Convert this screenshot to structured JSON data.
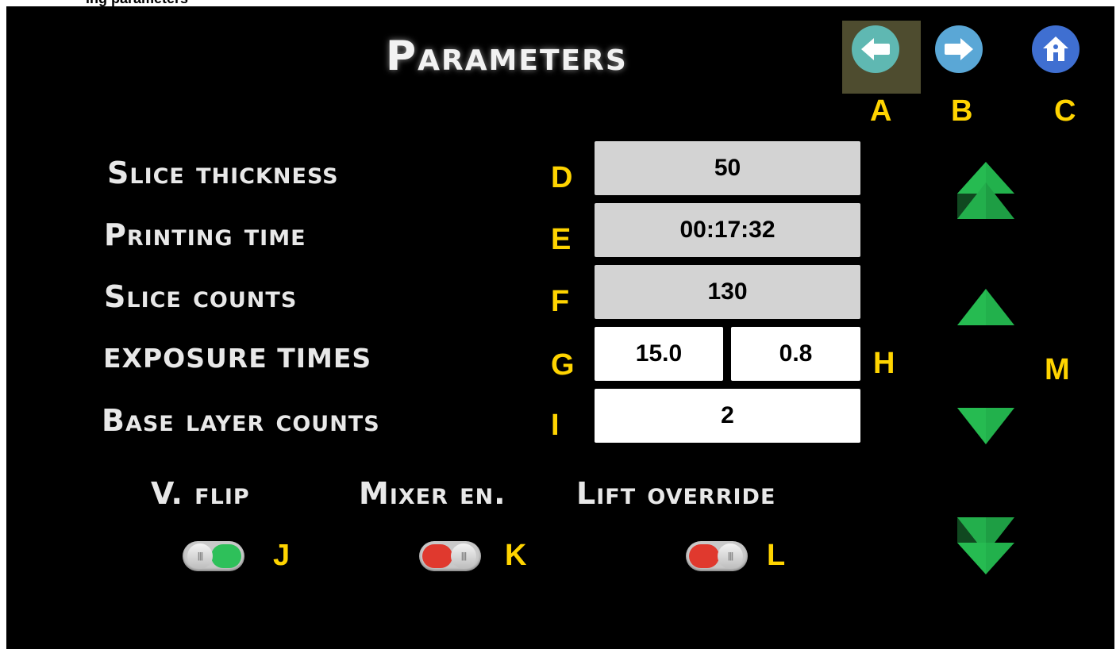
{
  "caption_fragment": "ing parameters",
  "title": "Parameters",
  "nav": {
    "back": {
      "icon": "arrow-left-icon",
      "color": "#5fb8b2"
    },
    "forward": {
      "icon": "arrow-right-icon",
      "color": "#5aa7d6"
    },
    "home": {
      "icon": "home-icon",
      "color": "#3f6fd1"
    }
  },
  "markers": {
    "A": "A",
    "B": "B",
    "C": "C",
    "D": "D",
    "E": "E",
    "F": "F",
    "G": "G",
    "H": "H",
    "I": "I",
    "J": "J",
    "K": "K",
    "L": "L",
    "M": "M"
  },
  "params": {
    "slice_thickness": {
      "label": "Slice thickness",
      "value": "50"
    },
    "printing_time": {
      "label": "Printing time",
      "value": "00:17:32"
    },
    "slice_counts": {
      "label": "Slice counts",
      "value": "130"
    },
    "exposure_times": {
      "label": "exposure times",
      "value_1": "15.0",
      "value_2": "0.8"
    },
    "base_layer_counts": {
      "label": "Base layer counts",
      "value": "2"
    }
  },
  "toggles": {
    "v_flip": {
      "label": "V. flip",
      "on": true,
      "color": "#2ec05a"
    },
    "mixer_en": {
      "label": "Mixer en.",
      "on": false,
      "color": "#e0392e"
    },
    "lift_override": {
      "label": "Lift override",
      "on": false,
      "color": "#e0392e"
    }
  },
  "scroll": {
    "page_up": "double-up-arrow-icon",
    "up": "up-arrow-icon",
    "down": "down-arrow-icon",
    "page_down": "double-down-arrow-icon",
    "color": "#22b14c"
  }
}
